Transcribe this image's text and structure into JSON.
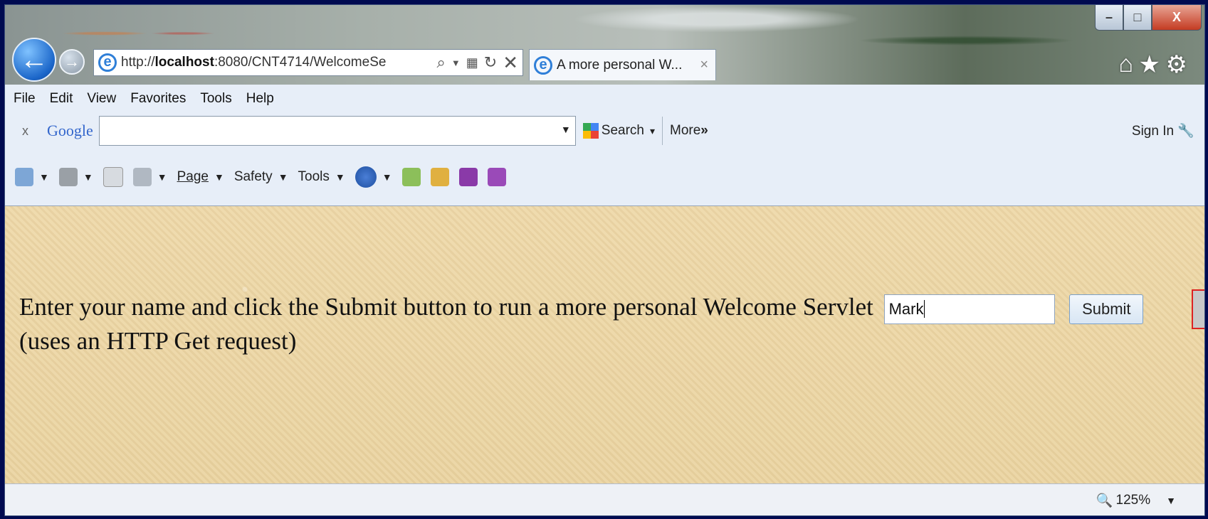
{
  "window": {
    "controls": {
      "minimize": "–",
      "maximize": "□",
      "close": "X"
    }
  },
  "nav": {
    "back_glyph": "←",
    "forward_glyph": "→",
    "address": {
      "prefix": "http://",
      "host": "localhost",
      "rest": ":8080/CNT4714/WelcomeSe"
    },
    "address_icons": [
      "search-icon",
      "dropdown-icon",
      "compat-icon",
      "refresh-icon",
      "stop-icon"
    ],
    "tab_title": "A more personal W...",
    "tab_close": "×",
    "right_icons": [
      "home-icon",
      "favorites-icon",
      "gear-icon"
    ]
  },
  "menubar": {
    "items": [
      "File",
      "Edit",
      "View",
      "Favorites",
      "Tools",
      "Help"
    ]
  },
  "google_toolbar": {
    "close": "x",
    "logo": "Google",
    "search_value": "",
    "search_label": "Search",
    "more_label": "More",
    "more_glyph": "»",
    "signin_label": "Sign In"
  },
  "command_bar": {
    "page_label": "Page",
    "safety_label": "Safety",
    "tools_label": "Tools"
  },
  "content": {
    "prompt_text": "Enter your name and click the Submit button to run a more personal Welcome Servlet",
    "name_value": "Mark",
    "submit_label": "Submit",
    "prompt_text_2": "(uses an HTTP Get request)"
  },
  "status": {
    "zoom": "125%"
  },
  "colors": {
    "frame": "#000a50",
    "toolbar_bg": "#e7eef8",
    "content_bg": "#ecd7a9"
  }
}
